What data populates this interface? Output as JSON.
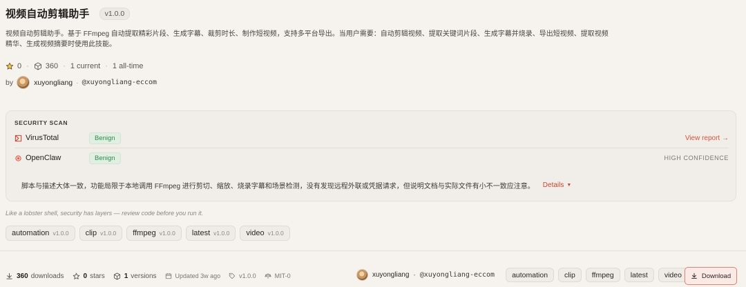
{
  "header": {
    "title": "视频自动剪辑助手",
    "version": "v1.0.0",
    "description": "视频自动剪辑助手。基于 FFmpeg 自动提取精彩片段、生成字幕、裁剪时长、制作短视频，支持多平台导出。当用户需要：自动剪辑视频、提取关键词片段、生成字幕并烧录、导出短视频、提取视频精华、生成视频摘要时使用此技能。"
  },
  "stats": {
    "stars": "0",
    "installs": "360",
    "current": "1 current",
    "all_time": "1 all-time",
    "sep": "·"
  },
  "author": {
    "by_label": "by",
    "username": "xuyongliang",
    "handle": "@xuyongliang-eccom",
    "sep": "·"
  },
  "security": {
    "label": "SECURITY SCAN",
    "virustotal": {
      "name": "VirusTotal",
      "verdict": "Benign",
      "link": "View report →",
      "icon": "virustotal-icon"
    },
    "openclaw": {
      "name": "OpenClaw",
      "verdict": "Benign",
      "confidence": "HIGH CONFIDENCE",
      "icon": "openclaw-icon"
    },
    "summary": "脚本与描述大体一致，功能局限于本地调用 FFmpeg 进行剪切、缩放、烧录字幕和场景检测，没有发现远程外联或凭据请求，但说明文档与实际文件有小不一致应注意。",
    "details_label": "Details",
    "details_caret": "▼"
  },
  "tagline": "Like a lobster shell, security has layers — review code before you run it.",
  "tags": [
    {
      "name": "automation",
      "version": "v1.0.0"
    },
    {
      "name": "clip",
      "version": "v1.0.0"
    },
    {
      "name": "ffmpeg",
      "version": "v1.0.0"
    },
    {
      "name": "latest",
      "version": "v1.0.0"
    },
    {
      "name": "video",
      "version": "v1.0.0"
    }
  ],
  "bottom": {
    "downloads_count": "360",
    "downloads_label": "downloads",
    "stars_count": "0",
    "stars_label": "stars",
    "versions_count": "1",
    "versions_label": "versions",
    "updated": "Updated 3w ago",
    "version": "v1.0.0",
    "license": "MIT-0",
    "username": "xuyongliang",
    "handle": "@xuyongliang-eccom",
    "sep": "·",
    "tags": [
      "automation",
      "clip",
      "ffmpeg",
      "latest",
      "video"
    ],
    "download_label": "Download"
  },
  "colors": {
    "accent": "#d4543e",
    "benign": "#2f8a49",
    "background": "#f6f3ef"
  }
}
